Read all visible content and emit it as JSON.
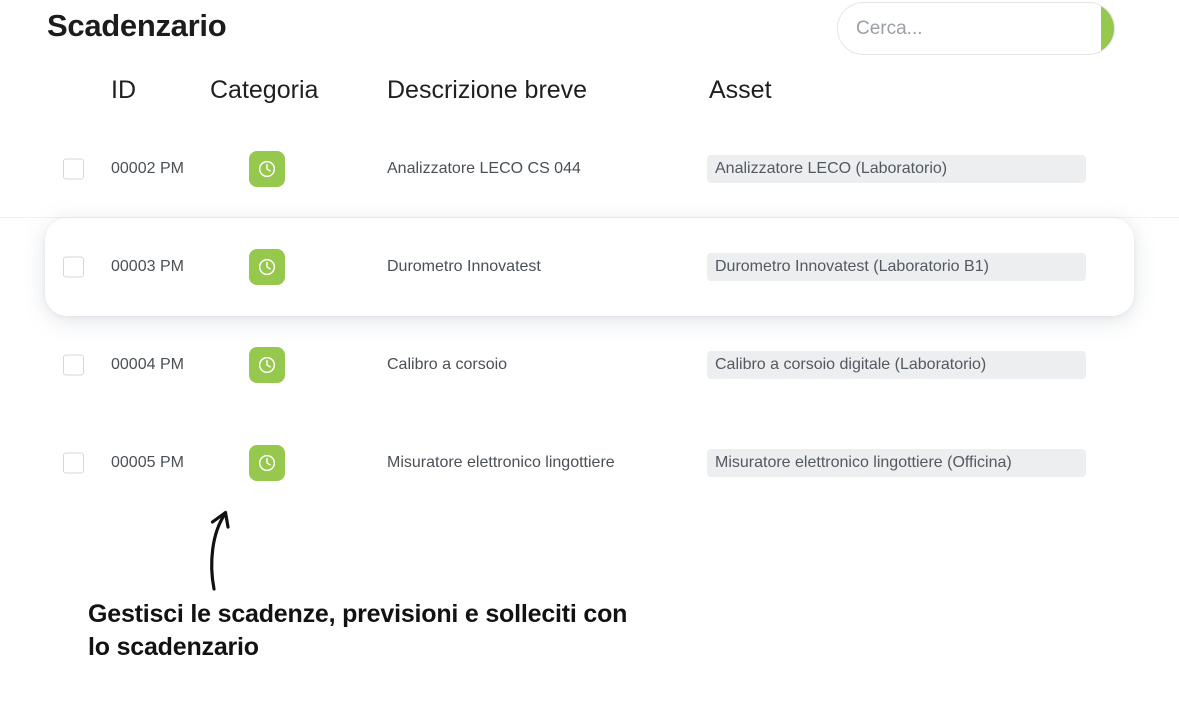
{
  "header": {
    "title": "Scadenzario",
    "search": {
      "placeholder": "Cerca...",
      "value": "",
      "icon": "search-icon",
      "button_color": "#95c84c"
    }
  },
  "table": {
    "columns": [
      "ID",
      "Categoria",
      "Descrizione breve",
      "Asset"
    ],
    "rows": [
      {
        "id": "00002 PM",
        "category_icon": "clock-icon",
        "category_color": "#95c84c",
        "description": "Analizzatore LECO CS 044",
        "asset": "Analizzatore LECO (Laboratorio)",
        "checked": false,
        "selected": false
      },
      {
        "id": "00003 PM",
        "category_icon": "clock-icon",
        "category_color": "#95c84c",
        "description": "Durometro Innovatest",
        "asset": "Durometro Innovatest (Laboratorio B1)",
        "checked": false,
        "selected": true
      },
      {
        "id": "00004 PM",
        "category_icon": "clock-icon",
        "category_color": "#95c84c",
        "description": "Calibro a corsoio",
        "asset": "Calibro a corsoio digitale (Laboratorio)",
        "checked": false,
        "selected": false
      },
      {
        "id": "00005 PM",
        "category_icon": "clock-icon",
        "category_color": "#95c84c",
        "description": "Misuratore elettronico lingottiere",
        "asset": "Misuratore elettronico lingottiere (Officina)",
        "checked": false,
        "selected": false
      }
    ]
  },
  "annotation": {
    "arrow_icon": "curved-up-arrow-icon",
    "caption": "Gestisci le scadenze, previsioni e solleciti con lo scadenzario"
  }
}
